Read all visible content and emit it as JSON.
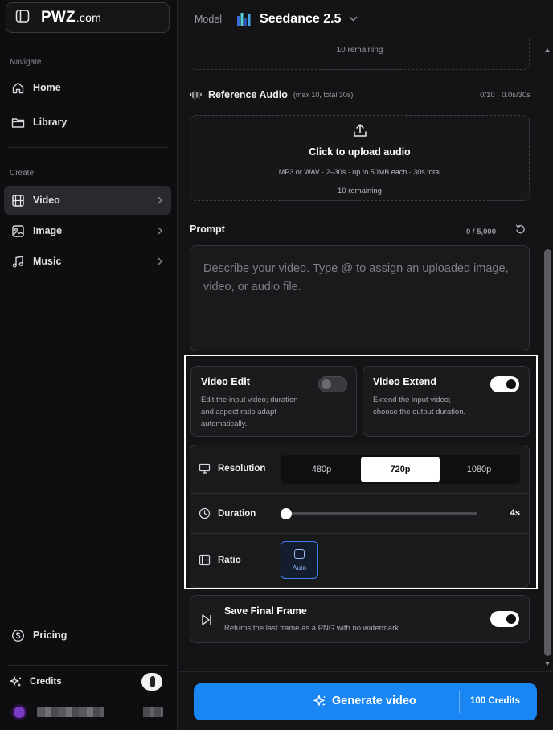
{
  "sidebar": {
    "brand": {
      "name": "PWZ",
      "tld": ".com"
    },
    "navigate_label": "Navigate",
    "nav": [
      {
        "label": "Home",
        "icon": "home-icon"
      },
      {
        "label": "Library",
        "icon": "folder-icon"
      }
    ],
    "create_label": "Create",
    "create": [
      {
        "label": "Video",
        "icon": "film-icon",
        "active": true
      },
      {
        "label": "Image",
        "icon": "image-icon",
        "active": false
      },
      {
        "label": "Music",
        "icon": "music-icon",
        "active": false
      }
    ],
    "pricing_label": "Pricing",
    "credits_label": "Credits"
  },
  "topbar": {
    "model_label": "Model",
    "model_name": "Seedance 2.5"
  },
  "upload_prev": {
    "remaining": "10 remaining"
  },
  "reference_audio": {
    "title": "Reference Audio",
    "subtitle": "(max 10, total 30s)",
    "status": "0/10 · 0.0s/30s",
    "cta": "Click to upload audio",
    "hint": "MP3 or WAV · 2–30s · up to 50MB each · 30s total",
    "remaining": "10 remaining"
  },
  "prompt": {
    "label": "Prompt",
    "count": "0 / 5,000",
    "placeholder": "Describe your video. Type @ to assign an uploaded image, video, or audio file."
  },
  "video_edit": {
    "title": "Video Edit",
    "desc_lines": [
      "Edit the input video; duration",
      "and aspect ratio adapt",
      "automatically."
    ],
    "enabled": false
  },
  "video_extend": {
    "title": "Video Extend",
    "desc_lines": [
      "Extend the input video;",
      "choose the output duration."
    ],
    "enabled": true
  },
  "settings": {
    "resolution_label": "Resolution",
    "resolution_options": [
      "480p",
      "720p",
      "1080p"
    ],
    "resolution_selected": "720p",
    "duration_label": "Duration",
    "duration_value": "4s",
    "duration_fraction": 0.0,
    "ratio_label": "Ratio",
    "ratio_value": "Auto"
  },
  "final_frame": {
    "title": "Save Final Frame",
    "desc": "Returns the last frame as a PNG with no watermark.",
    "enabled": true
  },
  "generate": {
    "label": "Generate video",
    "credits": "100 Credits"
  },
  "colors": {
    "accent": "#1a86f3",
    "background": "#141416",
    "sidebar": "#0e0e10",
    "ratio_accent": "#3c7ff0"
  }
}
